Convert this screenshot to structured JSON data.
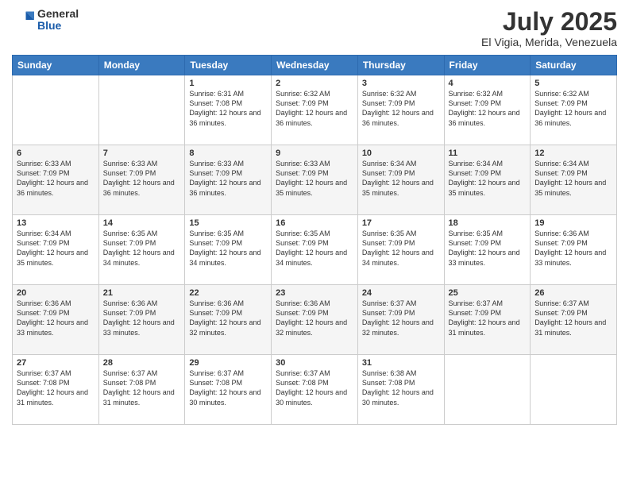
{
  "logo": {
    "general": "General",
    "blue": "Blue"
  },
  "title": "July 2025",
  "subtitle": "El Vigia, Merida, Venezuela",
  "headers": [
    "Sunday",
    "Monday",
    "Tuesday",
    "Wednesday",
    "Thursday",
    "Friday",
    "Saturday"
  ],
  "weeks": [
    [
      {
        "day": "",
        "info": ""
      },
      {
        "day": "",
        "info": ""
      },
      {
        "day": "1",
        "info": "Sunrise: 6:31 AM\nSunset: 7:08 PM\nDaylight: 12 hours and 36 minutes."
      },
      {
        "day": "2",
        "info": "Sunrise: 6:32 AM\nSunset: 7:09 PM\nDaylight: 12 hours and 36 minutes."
      },
      {
        "day": "3",
        "info": "Sunrise: 6:32 AM\nSunset: 7:09 PM\nDaylight: 12 hours and 36 minutes."
      },
      {
        "day": "4",
        "info": "Sunrise: 6:32 AM\nSunset: 7:09 PM\nDaylight: 12 hours and 36 minutes."
      },
      {
        "day": "5",
        "info": "Sunrise: 6:32 AM\nSunset: 7:09 PM\nDaylight: 12 hours and 36 minutes."
      }
    ],
    [
      {
        "day": "6",
        "info": "Sunrise: 6:33 AM\nSunset: 7:09 PM\nDaylight: 12 hours and 36 minutes."
      },
      {
        "day": "7",
        "info": "Sunrise: 6:33 AM\nSunset: 7:09 PM\nDaylight: 12 hours and 36 minutes."
      },
      {
        "day": "8",
        "info": "Sunrise: 6:33 AM\nSunset: 7:09 PM\nDaylight: 12 hours and 36 minutes."
      },
      {
        "day": "9",
        "info": "Sunrise: 6:33 AM\nSunset: 7:09 PM\nDaylight: 12 hours and 35 minutes."
      },
      {
        "day": "10",
        "info": "Sunrise: 6:34 AM\nSunset: 7:09 PM\nDaylight: 12 hours and 35 minutes."
      },
      {
        "day": "11",
        "info": "Sunrise: 6:34 AM\nSunset: 7:09 PM\nDaylight: 12 hours and 35 minutes."
      },
      {
        "day": "12",
        "info": "Sunrise: 6:34 AM\nSunset: 7:09 PM\nDaylight: 12 hours and 35 minutes."
      }
    ],
    [
      {
        "day": "13",
        "info": "Sunrise: 6:34 AM\nSunset: 7:09 PM\nDaylight: 12 hours and 35 minutes."
      },
      {
        "day": "14",
        "info": "Sunrise: 6:35 AM\nSunset: 7:09 PM\nDaylight: 12 hours and 34 minutes."
      },
      {
        "day": "15",
        "info": "Sunrise: 6:35 AM\nSunset: 7:09 PM\nDaylight: 12 hours and 34 minutes."
      },
      {
        "day": "16",
        "info": "Sunrise: 6:35 AM\nSunset: 7:09 PM\nDaylight: 12 hours and 34 minutes."
      },
      {
        "day": "17",
        "info": "Sunrise: 6:35 AM\nSunset: 7:09 PM\nDaylight: 12 hours and 34 minutes."
      },
      {
        "day": "18",
        "info": "Sunrise: 6:35 AM\nSunset: 7:09 PM\nDaylight: 12 hours and 33 minutes."
      },
      {
        "day": "19",
        "info": "Sunrise: 6:36 AM\nSunset: 7:09 PM\nDaylight: 12 hours and 33 minutes."
      }
    ],
    [
      {
        "day": "20",
        "info": "Sunrise: 6:36 AM\nSunset: 7:09 PM\nDaylight: 12 hours and 33 minutes."
      },
      {
        "day": "21",
        "info": "Sunrise: 6:36 AM\nSunset: 7:09 PM\nDaylight: 12 hours and 33 minutes."
      },
      {
        "day": "22",
        "info": "Sunrise: 6:36 AM\nSunset: 7:09 PM\nDaylight: 12 hours and 32 minutes."
      },
      {
        "day": "23",
        "info": "Sunrise: 6:36 AM\nSunset: 7:09 PM\nDaylight: 12 hours and 32 minutes."
      },
      {
        "day": "24",
        "info": "Sunrise: 6:37 AM\nSunset: 7:09 PM\nDaylight: 12 hours and 32 minutes."
      },
      {
        "day": "25",
        "info": "Sunrise: 6:37 AM\nSunset: 7:09 PM\nDaylight: 12 hours and 31 minutes."
      },
      {
        "day": "26",
        "info": "Sunrise: 6:37 AM\nSunset: 7:09 PM\nDaylight: 12 hours and 31 minutes."
      }
    ],
    [
      {
        "day": "27",
        "info": "Sunrise: 6:37 AM\nSunset: 7:08 PM\nDaylight: 12 hours and 31 minutes."
      },
      {
        "day": "28",
        "info": "Sunrise: 6:37 AM\nSunset: 7:08 PM\nDaylight: 12 hours and 31 minutes."
      },
      {
        "day": "29",
        "info": "Sunrise: 6:37 AM\nSunset: 7:08 PM\nDaylight: 12 hours and 30 minutes."
      },
      {
        "day": "30",
        "info": "Sunrise: 6:37 AM\nSunset: 7:08 PM\nDaylight: 12 hours and 30 minutes."
      },
      {
        "day": "31",
        "info": "Sunrise: 6:38 AM\nSunset: 7:08 PM\nDaylight: 12 hours and 30 minutes."
      },
      {
        "day": "",
        "info": ""
      },
      {
        "day": "",
        "info": ""
      }
    ]
  ]
}
